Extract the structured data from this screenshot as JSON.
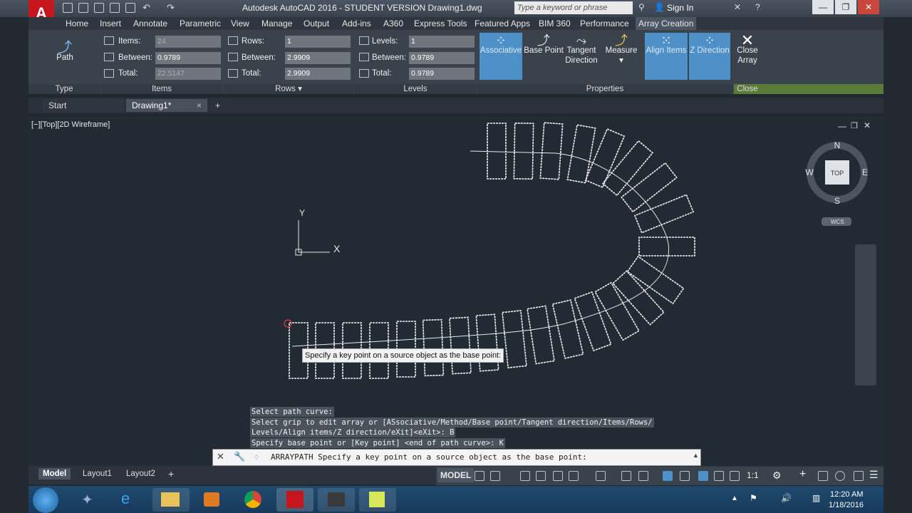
{
  "titlebar": {
    "title": "Autodesk AutoCAD 2016 - STUDENT VERSION   Drawing1.dwg",
    "search_placeholder": "Type a keyword or phrase",
    "sign_in": "Sign In"
  },
  "menu_tabs": [
    "Home",
    "Insert",
    "Annotate",
    "Parametric",
    "View",
    "Manage",
    "Output",
    "Add-ins",
    "A360",
    "Express Tools",
    "Featured Apps",
    "BIM 360",
    "Performance",
    "Array Creation"
  ],
  "ribbon": {
    "type_panel": {
      "button": "Path",
      "title": "Type"
    },
    "items_panel": {
      "title": "Items",
      "items_label": "Items:",
      "items_value": "24",
      "between_label": "Between:",
      "between_value": "0.9789",
      "total_label": "Total:",
      "total_value": "22.5147"
    },
    "rows_panel": {
      "title": "Rows",
      "rows_label": "Rows:",
      "rows_value": "1",
      "between_label": "Between:",
      "between_value": "2.9909",
      "total_label": "Total:",
      "total_value": "2.9909"
    },
    "levels_panel": {
      "title": "Levels",
      "levels_label": "Levels:",
      "levels_value": "1",
      "between_label": "Between:",
      "between_value": "0.9789",
      "total_label": "Total:",
      "total_value": "0.9789"
    },
    "properties_panel": {
      "title": "Properties",
      "associative": "Associative",
      "base_point": "Base Point",
      "tangent_direction_1": "Tangent",
      "tangent_direction_2": "Direction",
      "measure": "Measure",
      "align_items": "Align Items",
      "z_direction": "Z Direction"
    },
    "close_panel": {
      "title": "Close",
      "close_1": "Close",
      "close_2": "Array"
    }
  },
  "file_tabs": {
    "start": "Start",
    "drawing": "Drawing1*",
    "close": "×",
    "add": "+"
  },
  "viewport": {
    "label": "[−][Top][2D Wireframe]",
    "viewcube": {
      "top": "TOP",
      "n": "N",
      "s": "S",
      "e": "E",
      "w": "W",
      "wcs": "WCS"
    },
    "ucs_x": "X",
    "ucs_y": "Y",
    "tooltip": "Specify a key point on a source object as the base point:"
  },
  "command": {
    "history": [
      "Select path curve:",
      "Select grip to edit array or [ASsociative/Method/Base point/Tangent direction/Items/Rows/",
      "Levels/Align items/Z direction/eXit]<eXit>: B",
      "Specify base point or [Key point] <end of path curve>: K"
    ],
    "prompt": "ARRAYPATH Specify a key point on a source object as the base point:"
  },
  "layout_tabs": [
    "Model",
    "Layout1",
    "Layout2"
  ],
  "status": {
    "model": "MODEL",
    "scale": "1:1"
  },
  "taskbar": {
    "time": "12:20 AM",
    "date": "1/18/2016"
  },
  "colors": {
    "accent": "#4e90c8",
    "background": "#222a33",
    "logo": "#c4161c"
  }
}
